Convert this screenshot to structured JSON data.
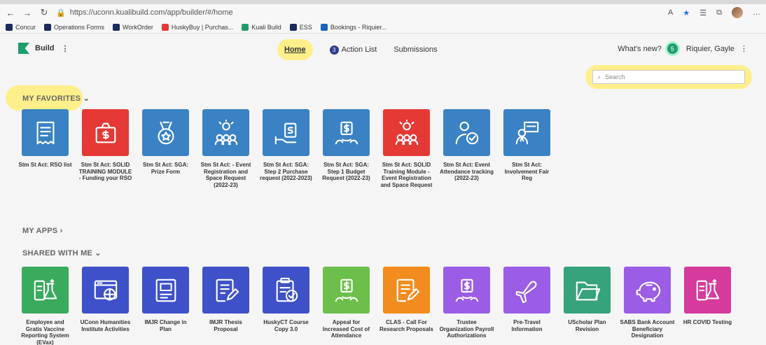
{
  "browser": {
    "url": "https://uconn.kualibuild.com/app/builder/#/home",
    "bookmarks": [
      "Concur",
      "Operations Forms",
      "WorkOrder",
      "HuskyBuy | Purchas...",
      "Kuali Build",
      "ESS",
      "Bookings - Riquier..."
    ]
  },
  "app": {
    "brand": "Build",
    "nav": {
      "home": "Home",
      "action_list": "Action List",
      "action_count": "3",
      "submissions": "Submissions"
    },
    "whats_new": "What's new?",
    "whats_new_count": "5",
    "user": "Riquier, Gayle",
    "search_placeholder": "Search"
  },
  "sections": {
    "favorites": "MY FAVORITES",
    "apps": "MY APPS",
    "shared": "SHARED WITH ME"
  },
  "favorites": [
    {
      "label": "Stm St Act: RSO list",
      "color": "#3b82c4",
      "icon": "receipt-icon"
    },
    {
      "label": "Stm St Act: SOLID TRAINING MODULE - Funding your RSO",
      "color": "#e53935",
      "icon": "money-bag-icon"
    },
    {
      "label": "Stm St Act: SGA: Prize Form",
      "color": "#3b82c4",
      "icon": "medal-icon"
    },
    {
      "label": "Stm St Act: - Event Registration and Space Request (2022-23)",
      "color": "#3b82c4",
      "icon": "idea-group-icon"
    },
    {
      "label": "Stm St Act: SGA: Step 2 Purchase request (2022-2023)",
      "color": "#3b82c4",
      "icon": "hand-money-icon"
    },
    {
      "label": "Stm St Act: SGA: Step 1 Budget Request (2022-23)",
      "color": "#3b82c4",
      "icon": "budget-icon"
    },
    {
      "label": "Stm St Act: SOLID Training Module - Event Registration and Space Request",
      "color": "#e53935",
      "icon": "idea-group-icon"
    },
    {
      "label": "Stm St Act: Event Attendance tracking (2022-23)",
      "color": "#3b82c4",
      "icon": "person-check-icon"
    },
    {
      "label": "Stm St Act: Involvement Fair Reg",
      "color": "#3b82c4",
      "icon": "people-presentation-icon"
    }
  ],
  "shared": [
    {
      "label": "Employee and Gratis Vaccine Reporting System (EVax)",
      "color": "#3aaa5c",
      "icon": "lab-icon"
    },
    {
      "label": "UConn Humanities Institute Activities",
      "color": "#3f51c8",
      "icon": "web-icon"
    },
    {
      "label": "IMJR Change in Plan",
      "color": "#3f51c8",
      "icon": "document-icon"
    },
    {
      "label": "IMJR Thesis Proposal",
      "color": "#3f51c8",
      "icon": "edit-document-icon"
    },
    {
      "label": "HuskyCT Course Copy 3.0",
      "color": "#3f51c8",
      "icon": "clipboard-check-icon"
    },
    {
      "label": "Appeal for Increased Cost of Attendance",
      "color": "#6cbf4a",
      "icon": "budget-icon"
    },
    {
      "label": "CLAS - Call For Research Proposals",
      "color": "#f28c1e",
      "icon": "edit-document-icon"
    },
    {
      "label": "Trustee Organization Payroll Authorizations",
      "color": "#9b5de5",
      "icon": "budget-icon"
    },
    {
      "label": "Pre-Travel Information",
      "color": "#9b5de5",
      "icon": "airplane-icon"
    },
    {
      "label": "UScholar Plan Revision",
      "color": "#36a37c",
      "icon": "folder-icon"
    },
    {
      "label": "SABS Bank Account Beneficiary Designation",
      "color": "#9b5de5",
      "icon": "piggy-bank-icon"
    },
    {
      "label": "HR COVID Testing",
      "color": "#d63a9d",
      "icon": "lab-icon"
    }
  ]
}
